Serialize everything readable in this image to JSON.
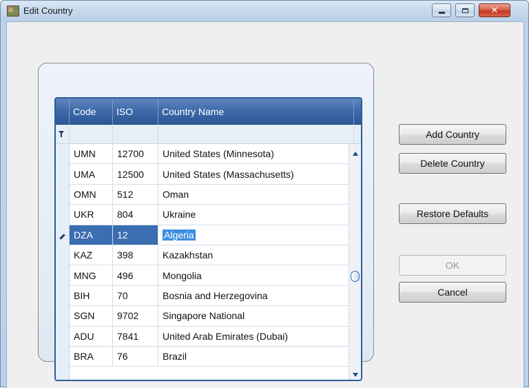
{
  "window": {
    "title": "Edit Country",
    "close_glyph": "✕"
  },
  "grid": {
    "columns": [
      "Code",
      "ISO",
      "Country Name"
    ],
    "rows": [
      {
        "code": "UMN",
        "iso": "12700",
        "name": "United States (Minnesota)"
      },
      {
        "code": "UMA",
        "iso": "12500",
        "name": "United States (Massachusetts)"
      },
      {
        "code": "OMN",
        "iso": "512",
        "name": "Oman"
      },
      {
        "code": "UKR",
        "iso": "804",
        "name": "Ukraine"
      },
      {
        "code": "DZA",
        "iso": "12",
        "name": "Algeria"
      },
      {
        "code": "KAZ",
        "iso": "398",
        "name": "Kazakhstan"
      },
      {
        "code": "MNG",
        "iso": "496",
        "name": "Mongolia"
      },
      {
        "code": "BIH",
        "iso": "70",
        "name": "Bosnia and Herzegovina"
      },
      {
        "code": "SGN",
        "iso": "9702",
        "name": "Singapore National"
      },
      {
        "code": "ADU",
        "iso": "7841",
        "name": "United Arab Emirates (Dubai)"
      },
      {
        "code": "BRA",
        "iso": "76",
        "name": "Brazil"
      }
    ],
    "selected_row_index": 4
  },
  "buttons": {
    "add_country": "Add Country",
    "delete_country": "Delete Country",
    "restore_defaults": "Restore Defaults",
    "ok": "OK",
    "cancel": "Cancel"
  },
  "icons": {
    "app": "country-map-icon",
    "filter": "filter-icon",
    "edit_row": "pencil-icon",
    "minimize": "minimize-icon",
    "maximize": "maximize-icon",
    "close": "close-icon"
  },
  "colors": {
    "grid_header": "#3d69a8",
    "selection": "#3b6db1",
    "close_button": "#c23a22"
  }
}
